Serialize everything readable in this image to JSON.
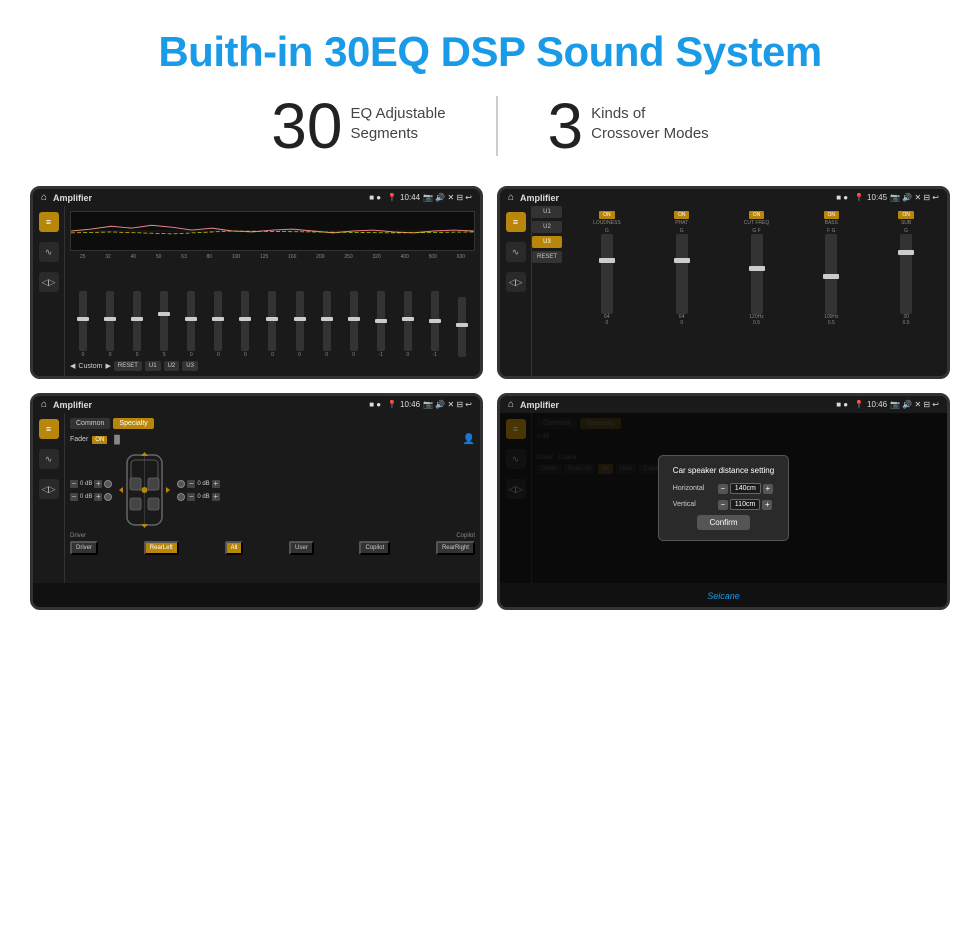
{
  "header": {
    "title": "Buith-in 30EQ DSP Sound System"
  },
  "stats": [
    {
      "number": "30",
      "label": "EQ Adjustable\nSegments"
    },
    {
      "number": "3",
      "label": "Kinds of\nCrossover Modes"
    }
  ],
  "screens": [
    {
      "id": "eq-screen",
      "statusBar": {
        "title": "Amplifier",
        "time": "10:44"
      },
      "type": "eq"
    },
    {
      "id": "crossover-screen",
      "statusBar": {
        "title": "Amplifier",
        "time": "10:45"
      },
      "type": "crossover"
    },
    {
      "id": "specialty-screen",
      "statusBar": {
        "title": "Amplifier",
        "time": "10:46"
      },
      "type": "specialty"
    },
    {
      "id": "dialog-screen",
      "statusBar": {
        "title": "Amplifier",
        "time": "10:46"
      },
      "type": "dialog"
    }
  ],
  "eq": {
    "frequencies": [
      "25",
      "32",
      "40",
      "50",
      "63",
      "80",
      "100",
      "125",
      "160",
      "200",
      "250",
      "320",
      "400",
      "500",
      "630"
    ],
    "values": [
      "0",
      "0",
      "0",
      "5",
      "0",
      "0",
      "0",
      "0",
      "0",
      "0",
      "0",
      "-1",
      "0",
      "-1",
      ""
    ],
    "presets": [
      "Custom",
      "RESET",
      "U1",
      "U2",
      "U3"
    ]
  },
  "crossover": {
    "channels": [
      "LOUDNESS",
      "PHAT",
      "CUT FREQ",
      "BASS",
      "SUB"
    ],
    "labels": [
      "G",
      "G",
      "G F",
      "F G",
      "G"
    ]
  },
  "specialty": {
    "tabs": [
      "Common",
      "Specialty"
    ],
    "faderLabel": "Fader",
    "faderState": "ON",
    "dbValues": [
      "0 dB",
      "0 dB",
      "0 dB",
      "0 dB"
    ],
    "bottomLabels": [
      "Driver",
      "Copilot",
      "RearLeft",
      "All",
      "User",
      "RearRight"
    ],
    "bottomButtons": [
      "Driver",
      "RearLeft",
      "All",
      "User",
      "Copilot",
      "RearRight"
    ]
  },
  "dialog": {
    "title": "Car speaker distance setting",
    "horizontalLabel": "Horizontal",
    "horizontalValue": "140cm",
    "verticalLabel": "Vertical",
    "verticalValue": "110cm",
    "confirmLabel": "Confirm"
  },
  "watermark": "Seicane"
}
